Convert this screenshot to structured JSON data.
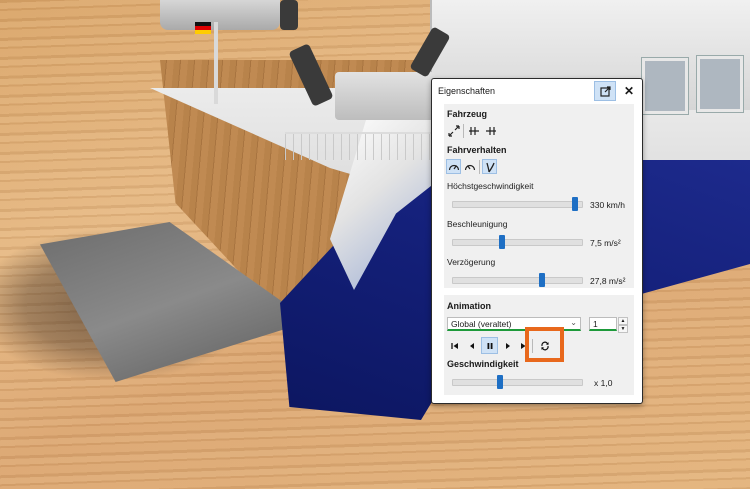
{
  "panel": {
    "title": "Eigenschaften",
    "popout_icon": "popout-icon",
    "close_glyph": "✕",
    "vehicle": {
      "header": "Fahrzeug",
      "icons": [
        "expand-icon",
        "couple-left-icon",
        "couple-right-icon"
      ]
    },
    "behavior": {
      "header": "Fahrverhalten",
      "icons": [
        "speedometer-icon",
        "speedometer-alt-icon",
        "curve-icon"
      ],
      "max_speed": {
        "label": "Höchstgeschwindigkeit",
        "value": "330 km/h",
        "level": 0.97
      },
      "acceleration": {
        "label": "Beschleunigung",
        "value": "7,5 m/s²",
        "level": 0.37
      },
      "deceleration": {
        "label": "Verzögerung",
        "value": "27,8 m/s²",
        "level": 0.7
      }
    },
    "animation": {
      "header": "Animation",
      "mode": "Global (veraltet)",
      "count": "1",
      "controls": [
        "skip-start-icon",
        "step-back-icon",
        "pause-icon",
        "play-icon",
        "skip-end-icon",
        "loop-icon"
      ],
      "speed": {
        "label": "Geschwindigkeit",
        "value": "x 1,0",
        "level": 0.36
      }
    }
  },
  "colors": {
    "accent": "#1e6fc4",
    "highlight": "#e8681c",
    "select_underline": "#1d9a3a"
  }
}
